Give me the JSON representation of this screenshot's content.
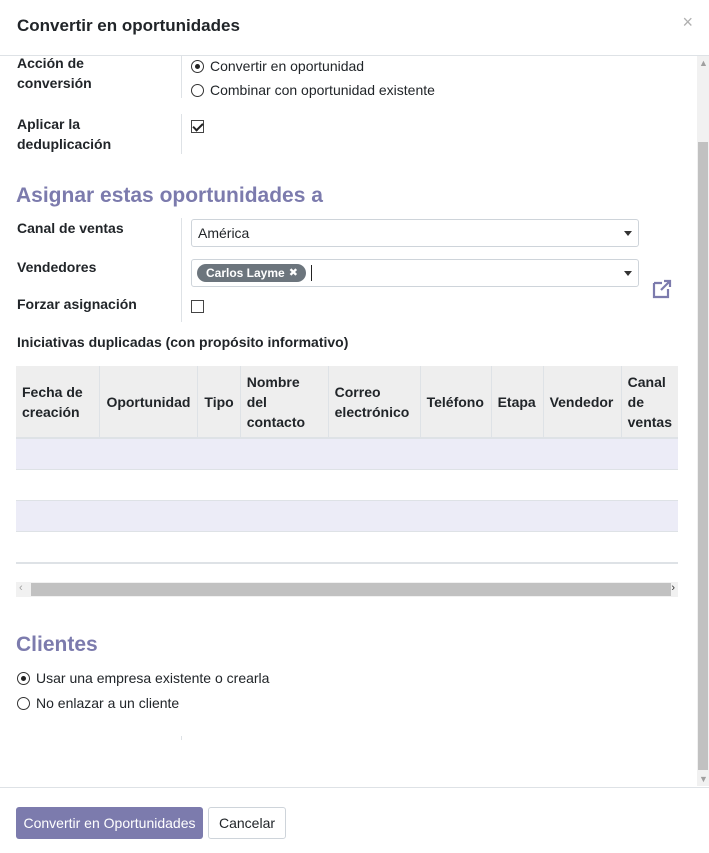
{
  "dialog": {
    "title": "Convertir en oportunidades",
    "close_glyph": "×"
  },
  "conversion": {
    "action_label_line1": "Acción de",
    "action_label_line2": "conversión",
    "options": [
      {
        "label": "Convertir en oportunidad",
        "selected": true
      },
      {
        "label": "Combinar con oportunidad existente",
        "selected": false
      }
    ],
    "dedup_label_line1": "Aplicar la",
    "dedup_label_line2": "deduplicación",
    "dedup_checked": true
  },
  "assign": {
    "title": "Asignar estas oportunidades a",
    "sales_channel_label": "Canal de ventas",
    "sales_channel_value": "América",
    "salespeople_label": "Vendedores",
    "salesperson_tag": "Carlos Layme",
    "force_label": "Forzar asignación",
    "force_checked": false
  },
  "duplicates": {
    "title": "Iniciativas duplicadas (con propósito informativo)",
    "columns": [
      [
        "Fecha de",
        "creación"
      ],
      [
        "Oportunidad"
      ],
      [
        "Tipo"
      ],
      [
        "Nombre",
        "del",
        "contacto"
      ],
      [
        "Correo",
        "electrónico"
      ],
      [
        "Teléfono"
      ],
      [
        "Etapa"
      ],
      [
        "Vendedor"
      ],
      [
        "Canal",
        "de",
        "ventas"
      ]
    ],
    "rows": [
      [],
      [],
      [],
      []
    ]
  },
  "customers": {
    "title": "Clientes",
    "options": [
      {
        "label": "Usar una empresa existente o crearla",
        "selected": true
      },
      {
        "label": "No enlazar a un cliente",
        "selected": false
      }
    ]
  },
  "footer": {
    "primary_label": "Convertir en Oportunidades",
    "cancel_label": "Cancelar"
  },
  "colors": {
    "accent": "#7c7bad",
    "row_stripe": "#ececf7"
  },
  "icons": {
    "external_link": "external-link-icon",
    "close": "close-icon"
  }
}
